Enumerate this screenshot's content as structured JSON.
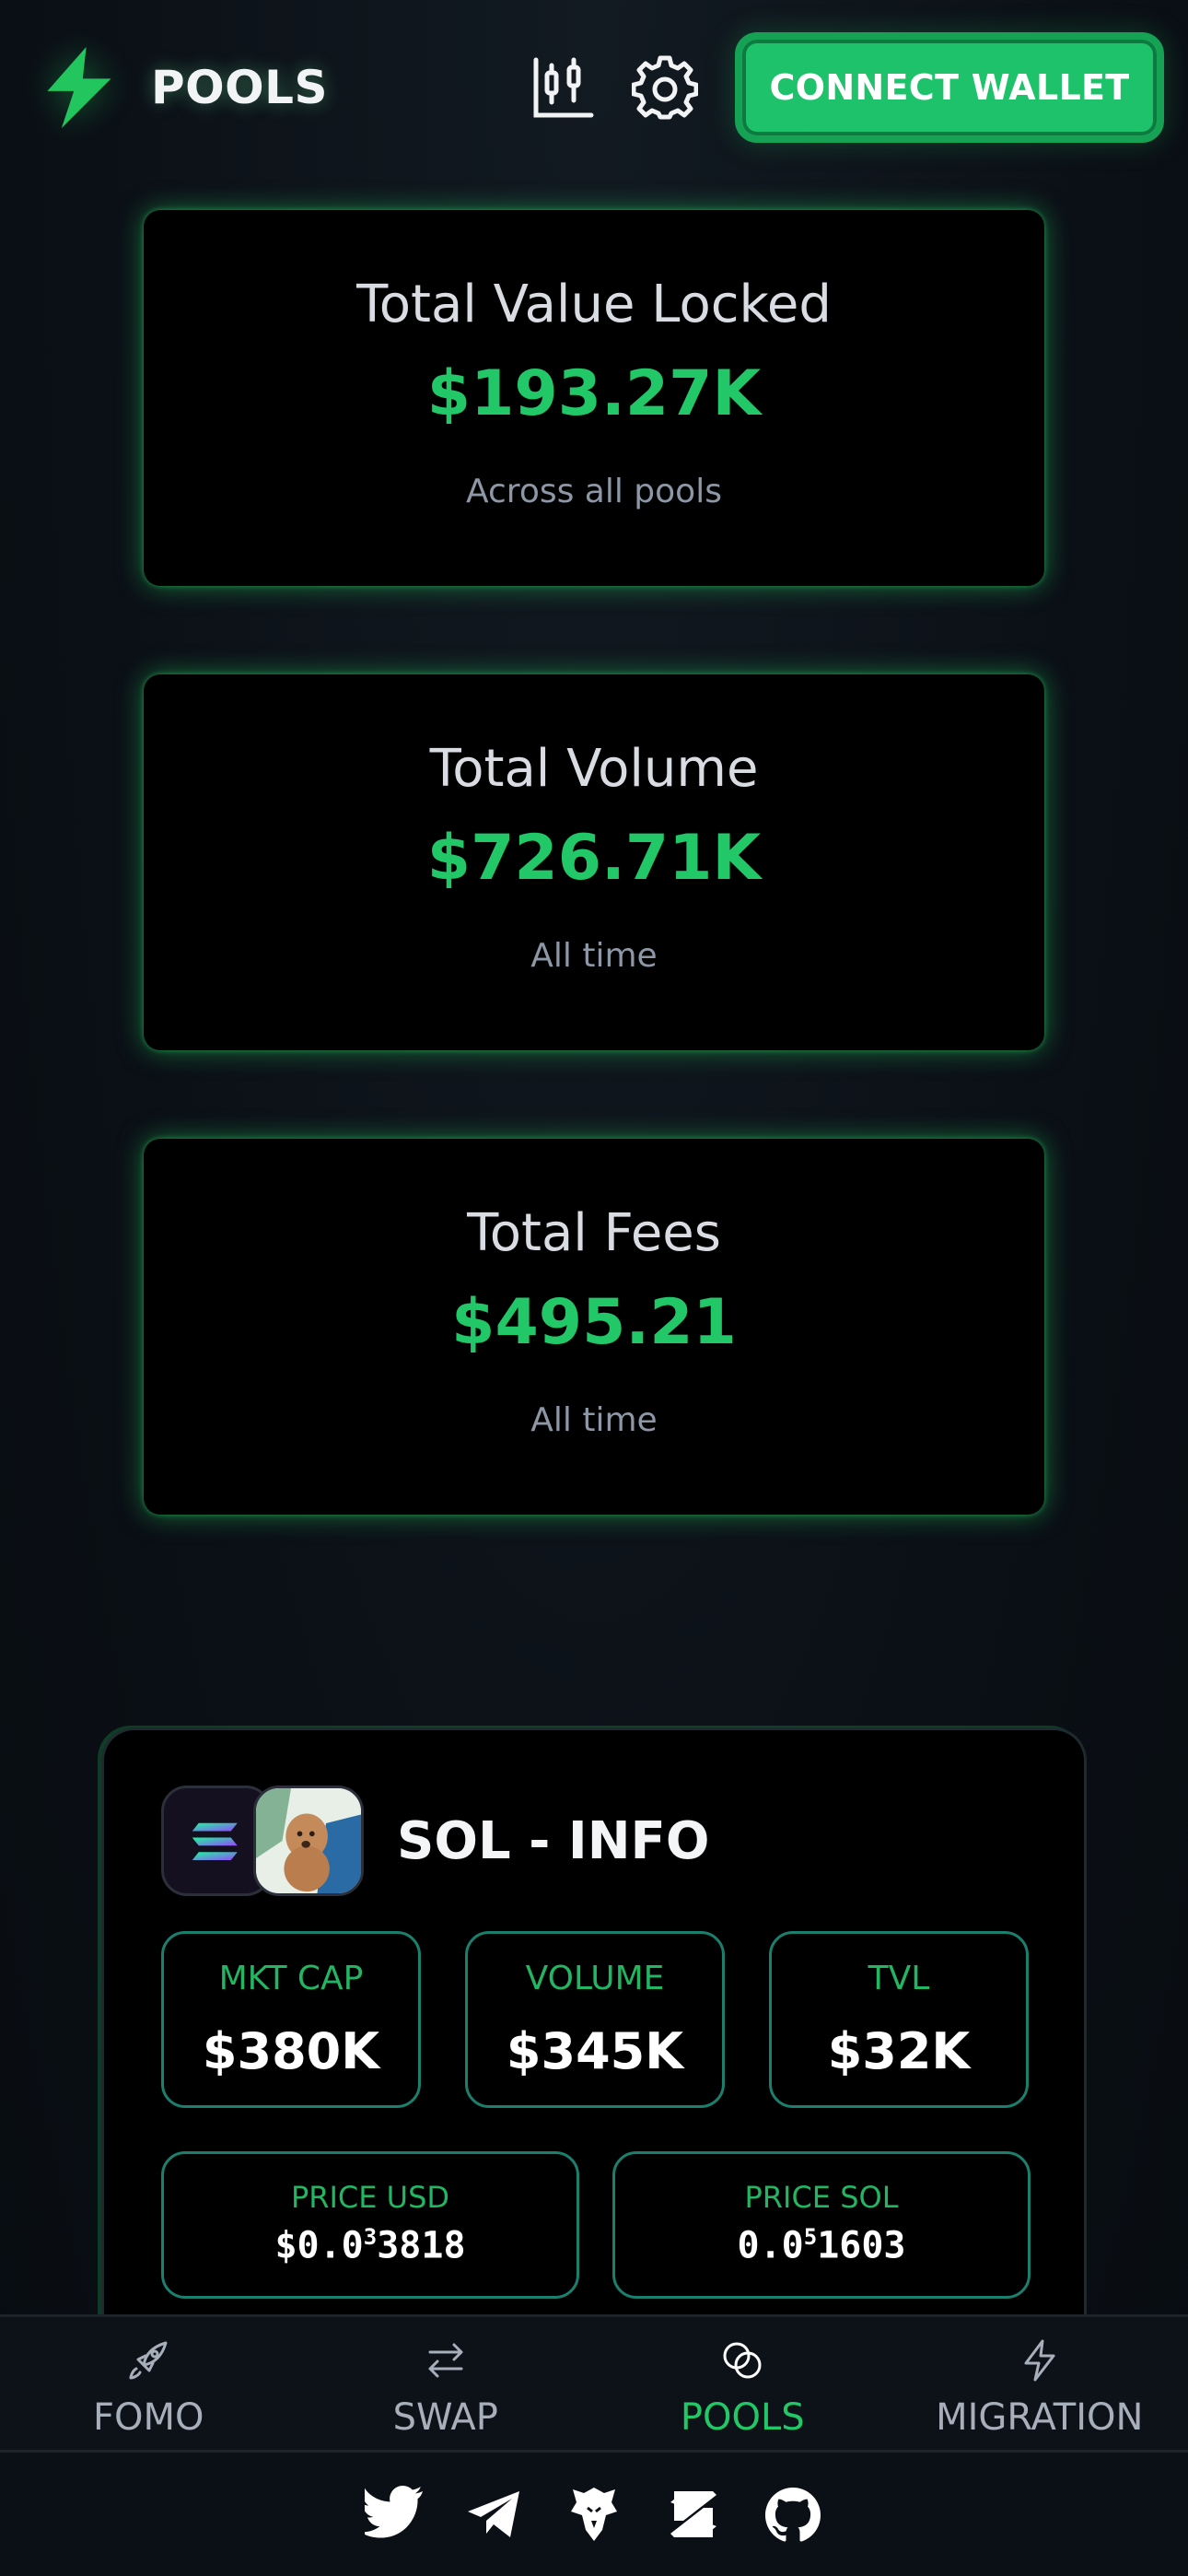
{
  "header": {
    "logo_text": "POOLS",
    "connect_label": "CONNECT WALLET",
    "icons": [
      "lightning-logo-icon",
      "chart-icon",
      "gear-icon"
    ],
    "accent": "#22c768"
  },
  "stats": [
    {
      "label": "Total Value Locked",
      "value": "$193.27K",
      "sub": "Across all pools"
    },
    {
      "label": "Total Volume",
      "value": "$726.71K",
      "sub": "All time"
    },
    {
      "label": "Total Fees",
      "value": "$495.21",
      "sub": "All time"
    }
  ],
  "info": {
    "title": "SOL - INFO",
    "metrics": [
      {
        "label": "MKT CAP",
        "value": "$380K"
      },
      {
        "label": "VOLUME",
        "value": "$345K"
      },
      {
        "label": "TVL",
        "value": "$32K"
      }
    ],
    "price_usd": {
      "label": "PRICE USD",
      "prefix": "$0.0",
      "zeros": "3",
      "digits": "3818"
    },
    "price_sol": {
      "label": "PRICE SOL",
      "prefix": "0.0",
      "zeros": "5",
      "digits": "1603"
    }
  },
  "nav": [
    {
      "label": "FOMO",
      "icon": "rocket-icon",
      "active": false
    },
    {
      "label": "SWAP",
      "icon": "swap-arrows-icon",
      "active": false
    },
    {
      "label": "POOLS",
      "icon": "pools-rings-icon",
      "active": true
    },
    {
      "label": "MIGRATION",
      "icon": "lightning-icon",
      "active": false
    }
  ],
  "socials": [
    "twitter-icon",
    "telegram-icon",
    "eagle-icon",
    "exchange-logo-icon",
    "github-icon"
  ]
}
